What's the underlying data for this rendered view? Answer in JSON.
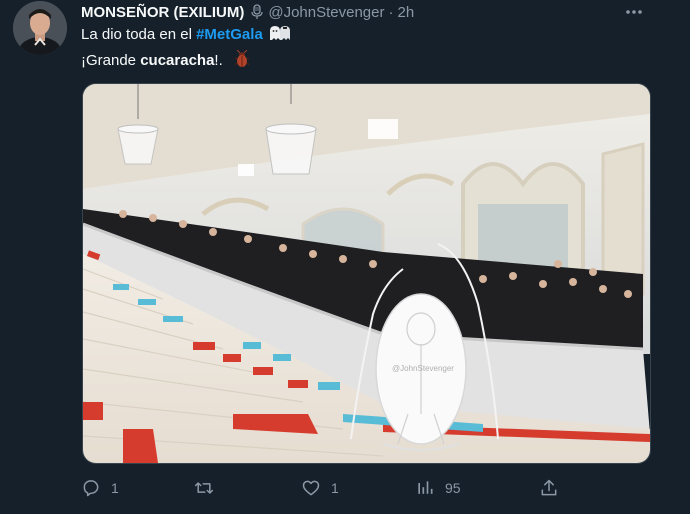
{
  "tweet": {
    "author_name": "MONSEÑOR (EXILIUM)",
    "author_handle": "@JohnStevenger",
    "separator": "·",
    "time": "2h",
    "text_line1_prefix": "La dio toda en el ",
    "hashtag": "#MetGala",
    "text_line2_prefix": "¡Grande ",
    "text_line2_bold": "cucaracha",
    "text_line2_suffix": "!.",
    "watermark": "@JohnStevenger"
  },
  "actions": {
    "reply_count": "1",
    "retweet_count": "",
    "like_count": "1",
    "views_count": "95"
  },
  "icons": {
    "verified_badge": "microphone-icon",
    "line1_emoji": "ghost-couple-icon",
    "line2_emoji": "cockroach-icon",
    "more": "more-icon",
    "reply": "reply-icon",
    "retweet": "retweet-icon",
    "like": "heart-icon",
    "views": "views-icon",
    "share": "share-icon"
  },
  "colors": {
    "background": "#15202b",
    "text": "#f7f9f9",
    "secondary_text": "#8b98a5",
    "link": "#1d9bf0"
  }
}
